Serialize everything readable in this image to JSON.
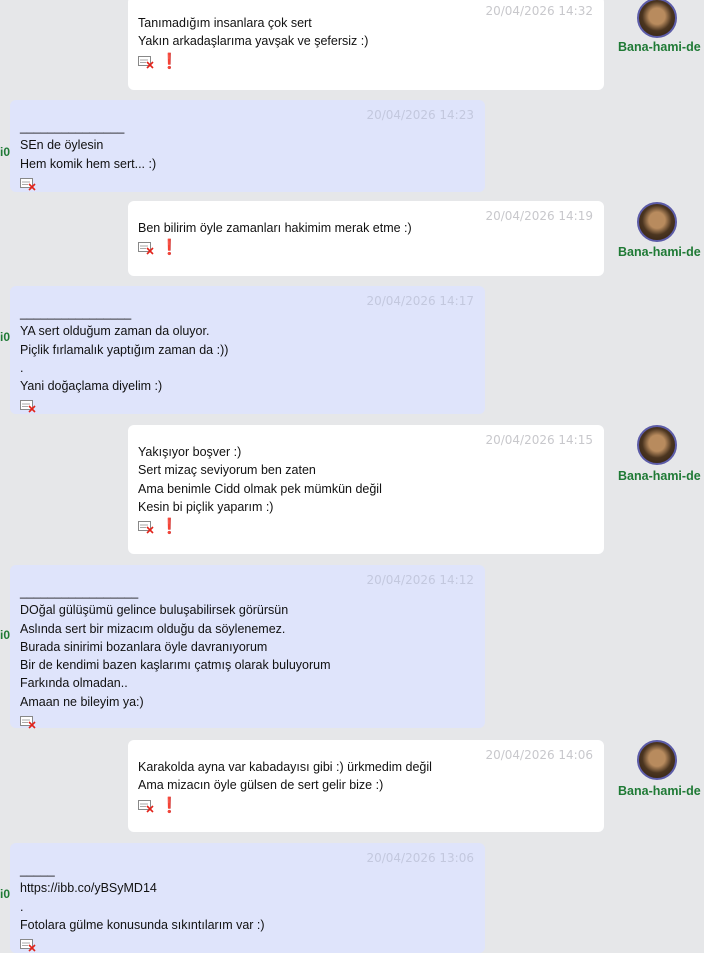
{
  "colors": {
    "page_bg": "#e6e7e9",
    "outgoing_bg": "#ffffff",
    "incoming_bg": "#dfe4fb",
    "username": "#1f7a35",
    "flag": "#e2231a"
  },
  "icons": {
    "report": "report-icon",
    "flag": "exclamation-icon",
    "flag_glyph": "❗"
  },
  "own_username": "Bana-hami-de",
  "other_user_fragment": "i0",
  "messages": [
    {
      "timestamp": "20/04/2026 14:32",
      "lines": [
        "Tanımadığım insanlara çok sert",
        "Yakın arkadaşlarıma yavşak ve şefersiz :)"
      ]
    },
    {
      "timestamp": "20/04/2026 14:23",
      "lines": [
        "_______________",
        "SEn de öylesin",
        "Hem komik hem sert... :)"
      ]
    },
    {
      "timestamp": "20/04/2026 14:19",
      "lines": [
        "Ben bilirim öyle zamanları hakimim merak etme :)"
      ]
    },
    {
      "timestamp": "20/04/2026 14:17",
      "lines": [
        "________________",
        "YA sert olduğum zaman da oluyor.",
        "Piçlik fırlamalık yaptığım zaman da :))",
        ".",
        "Yani doğaçlama diyelim :)"
      ]
    },
    {
      "timestamp": "20/04/2026 14:15",
      "lines": [
        "Yakışıyor boşver :)",
        "Sert mizaç seviyorum ben zaten",
        "Ama benimle Cidd olmak pek mümkün değil",
        "Kesin bi piçlik yaparım :)"
      ]
    },
    {
      "timestamp": "20/04/2026 14:12",
      "lines": [
        "_________________",
        "DOğal gülüşümü gelince buluşabilirsek görürsün",
        "Aslında sert bir mizacım olduğu da söylenemez.",
        "Burada sinirimi bozanlara öyle davranıyorum",
        "Bir de kendimi bazen kaşlarımı çatmış olarak buluyorum",
        "Farkında olmadan..",
        "Amaan ne bileyim ya:)"
      ]
    },
    {
      "timestamp": "20/04/2026 14:06",
      "lines": [
        "Karakolda ayna var kabadayısı gibi :) ürkmedim değil",
        "Ama mizacın öyle gülsen de sert gelir bize :)"
      ]
    },
    {
      "timestamp": "20/04/2026 13:06",
      "lines": [
        "_____",
        "https://ibb.co/yBSyMD14",
        ".",
        "Fotolara gülme konusunda sıkıntılarım var :)"
      ]
    }
  ]
}
